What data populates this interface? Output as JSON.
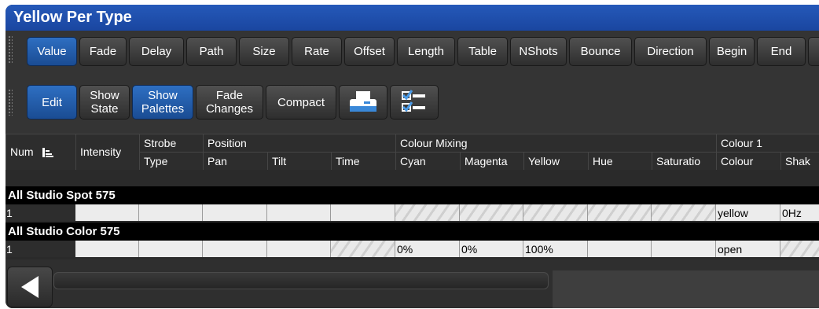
{
  "window": {
    "title": "Yellow Per Type"
  },
  "toolbar1": {
    "buttons": [
      "Value",
      "Fade",
      "Delay",
      "Path",
      "Size",
      "Rate",
      "Offset",
      "Length",
      "Table",
      "NShots",
      "Bounce",
      "Direction",
      "Begin",
      "End"
    ]
  },
  "toolbar2": {
    "edit": "Edit",
    "show_state": [
      "Show",
      "State"
    ],
    "show_palettes": [
      "Show",
      "Palettes"
    ],
    "fade_changes": [
      "Fade",
      "Changes"
    ],
    "compact": "Compact",
    "icons": [
      "print-icon",
      "checklist-icon"
    ]
  },
  "grid": {
    "num_label": "Num",
    "intensity_label": "Intensity",
    "groups_top": [
      "Strobe",
      "Position",
      "Colour Mixing",
      "Colour 1"
    ],
    "columns_bottom": [
      "Type",
      "Pan",
      "Tilt",
      "Time",
      "Cyan",
      "Magenta",
      "Yellow",
      "Hue",
      "Saturatio",
      "Colour",
      "Shak"
    ],
    "fixture_groups": [
      {
        "name": "All Studio Spot 575",
        "num": "1",
        "cells": [
          "",
          "",
          "",
          "",
          "",
          "",
          "",
          "",
          "",
          "",
          "yellow",
          "0Hz"
        ]
      },
      {
        "name": "All Studio Color 575",
        "num": "1",
        "cells": [
          "",
          "",
          "",
          "",
          "",
          "0%",
          "0%",
          "100%",
          "",
          "",
          "open",
          ""
        ]
      }
    ]
  },
  "colors": {
    "title_bar": "#2559b9",
    "active_button": "#2266bb"
  }
}
